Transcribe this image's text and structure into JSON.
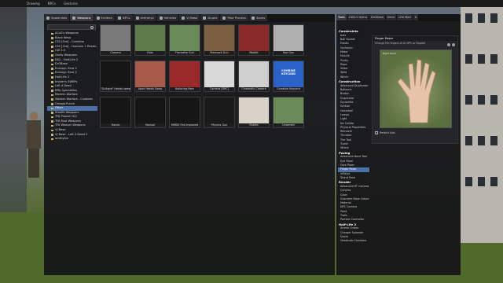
{
  "top_menu": [
    "Drawing",
    "NPCs",
    "Gestures"
  ],
  "spawn_tabs": [
    {
      "label": "Spawnlists",
      "active": false
    },
    {
      "label": "Weapons",
      "active": true
    },
    {
      "label": "Entities",
      "active": false
    },
    {
      "label": "NPCs",
      "active": false
    },
    {
      "label": "simfphys",
      "active": false
    },
    {
      "label": "Vehicles",
      "active": false
    },
    {
      "label": "VJ Base",
      "active": false
    },
    {
      "label": "Dupes",
      "active": false
    },
    {
      "label": "Post Process",
      "active": false
    },
    {
      "label": "Saves",
      "active": false
    }
  ],
  "tree_items": [
    {
      "label": "ACoS's Weapons",
      "selected": false
    },
    {
      "label": "Black Mesa",
      "selected": false
    },
    {
      "label": "CS2 [Ore] - Combine",
      "selected": false
    },
    {
      "label": "CS2 [Ore] - Humans + Resist...",
      "selected": false
    },
    {
      "label": "CW 2.0",
      "selected": false
    },
    {
      "label": "Dorky Weapons",
      "selected": false
    },
    {
      "label": "DS2 - Half-Life 2",
      "selected": false
    },
    {
      "label": "DrGBase",
      "selected": false
    },
    {
      "label": "Entropy: Zero 2",
      "selected": false
    },
    {
      "label": "Entropy: Zero 2",
      "selected": false
    },
    {
      "label": "Half-Life 2",
      "selected": false
    },
    {
      "label": "Insider's SWEPs",
      "selected": false
    },
    {
      "label": "Left 4 Dead",
      "selected": false
    },
    {
      "label": "M9k Specialties",
      "selected": false
    },
    {
      "label": "Modern Warfare",
      "selected": false
    },
    {
      "label": "Modern Warfare - Customs",
      "selected": false
    },
    {
      "label": "Omega Punch",
      "selected": false
    },
    {
      "label": "Other",
      "selected": true
    },
    {
      "label": "Stealth Weapons",
      "selected": false
    },
    {
      "label": "TFA Project HL2",
      "selected": false
    },
    {
      "label": "TFA Rust Weapons",
      "selected": false
    },
    {
      "label": "TFA Weaver Weapons",
      "selected": false
    },
    {
      "label": "VJ Base",
      "selected": false
    },
    {
      "label": "VJ Base - Left 4 Dead 2",
      "selected": false
    },
    {
      "label": "amthyfus",
      "selected": false
    }
  ],
  "weapons": [
    {
      "label": "Camera",
      "thumb": "#7a7a7a"
    },
    {
      "label": "Fists",
      "thumb": "#5c7a4a"
    },
    {
      "label": "Flechette Gun",
      "thumb": "#6a8a5a"
    },
    {
      "label": "Manhack Gun",
      "thumb": "#7a6040"
    },
    {
      "label": "Medkit",
      "thumb": "#8a2a2a"
    },
    {
      "label": "Tool Gun",
      "thumb": "#b0b0b0"
    },
    {
      "label": "\"Gullope\" Hands swep",
      "thumb": "#161616"
    },
    {
      "label": "Apex Hands Swep",
      "thumb": "#a85a4a"
    },
    {
      "label": "Balloring Ram",
      "thumb": "#9a2a2a"
    },
    {
      "label": "Camera [DRC]",
      "thumb": "#d8d8d8"
    },
    {
      "label": "Cinematic Camera",
      "thumb": "#cfcfcf"
    },
    {
      "label": "Combine Keycard",
      "thumb": "#2a62c8"
    },
    {
      "label": "Hands",
      "thumb": "#161616"
    },
    {
      "label": "Manual",
      "thumb": "#161616"
    },
    {
      "label": "MMDS Fist Improved",
      "thumb": "#161616"
    },
    {
      "label": "Physics Gun",
      "thumb": "#1a1a1a"
    },
    {
      "label": "Rubiks",
      "thumb": "#d9d2c9"
    },
    {
      "label": "Unarmed",
      "thumb": "#6a8a5a"
    }
  ],
  "combine_keycard_text": "COMBINE KEYCARD",
  "right_tabs": [
    {
      "label": "Tools",
      "active": true
    },
    {
      "label": "CW2.0 menu",
      "active": false
    },
    {
      "label": "DrGBase",
      "active": false
    },
    {
      "label": "Drive",
      "active": false
    },
    {
      "label": "Life Mod",
      "active": false
    },
    {
      "label": "U",
      "active": false
    }
  ],
  "right_list": [
    {
      "type": "cat",
      "label": "Constraints"
    },
    {
      "type": "itm",
      "label": "Axis"
    },
    {
      "type": "itm",
      "label": "Ball Socket"
    },
    {
      "type": "itm",
      "label": "Elastic"
    },
    {
      "type": "itm",
      "label": "Hydraulic"
    },
    {
      "type": "itm",
      "label": "Motor"
    },
    {
      "type": "itm",
      "label": "Muscle"
    },
    {
      "type": "itm",
      "label": "Pulley"
    },
    {
      "type": "itm",
      "label": "Rope"
    },
    {
      "type": "itm",
      "label": "Slider"
    },
    {
      "type": "itm",
      "label": "Weld"
    },
    {
      "type": "itm",
      "label": "Winch"
    },
    {
      "type": "cat",
      "label": "Construction"
    },
    {
      "type": "itm",
      "label": "Advanced Duplicator"
    },
    {
      "type": "itm",
      "label": "Balloons"
    },
    {
      "type": "itm",
      "label": "Button"
    },
    {
      "type": "itm",
      "label": "Duplicator"
    },
    {
      "type": "itm",
      "label": "Dynamite"
    },
    {
      "type": "itm",
      "label": "Emitter"
    },
    {
      "type": "itm",
      "label": "Hoverball"
    },
    {
      "type": "itm",
      "label": "Lamps"
    },
    {
      "type": "itm",
      "label": "Light"
    },
    {
      "type": "itm",
      "label": "No Collide"
    },
    {
      "type": "itm",
      "label": "Physical Properties"
    },
    {
      "type": "itm",
      "label": "Remover"
    },
    {
      "type": "itm",
      "label": "Thruster"
    },
    {
      "type": "itm",
      "label": "Tire Tool"
    },
    {
      "type": "itm",
      "label": "Turret"
    },
    {
      "type": "itm",
      "label": "Wheel"
    },
    {
      "type": "cat",
      "label": "Posing"
    },
    {
      "type": "itm",
      "label": "Advanced Bone Tool"
    },
    {
      "type": "itm",
      "label": "Eye Poser"
    },
    {
      "type": "itm",
      "label": "Face Poser"
    },
    {
      "type": "itm",
      "label": "Finger Poser",
      "selected": true
    },
    {
      "type": "itm",
      "label": "Inflator"
    },
    {
      "type": "itm",
      "label": "Stand Pose"
    },
    {
      "type": "cat",
      "label": "Render"
    },
    {
      "type": "itm",
      "label": "Advanced RT Camera"
    },
    {
      "type": "itm",
      "label": "Camera"
    },
    {
      "type": "itm",
      "label": "Color"
    },
    {
      "type": "itm",
      "label": "Gracome Base Colour"
    },
    {
      "type": "itm",
      "label": "Material"
    },
    {
      "type": "itm",
      "label": "NPC Camera"
    },
    {
      "type": "itm",
      "label": "Paint"
    },
    {
      "type": "itm",
      "label": "Trails"
    },
    {
      "type": "itm",
      "label": "Particle Controller"
    },
    {
      "type": "cat",
      "label": "Half-Life 2"
    },
    {
      "type": "itm",
      "label": "Ammo Crates"
    },
    {
      "type": "itm",
      "label": "Charger Spawner"
    },
    {
      "type": "itm",
      "label": "Doors"
    },
    {
      "type": "itm",
      "label": "Headcrab Canisters"
    }
  ],
  "tool_panel": {
    "title": "Finger Poser",
    "description": "Change the fingers of an NPC or Ragdoll",
    "preview_label": "Right Hand",
    "footer": "Restrict Axis"
  }
}
